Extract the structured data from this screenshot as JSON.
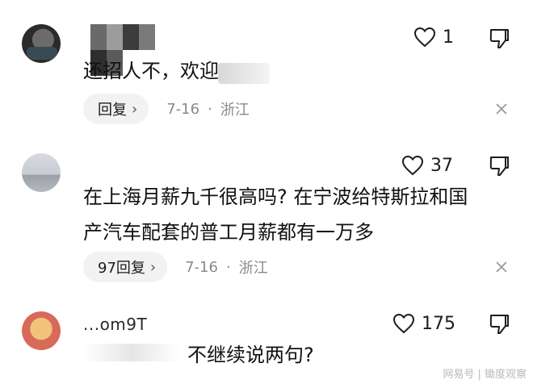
{
  "comments": [
    {
      "username": "",
      "likes": "1",
      "text": "还招人不，欢迎",
      "reply_label": "回复",
      "date": "7-16",
      "region": "浙江"
    },
    {
      "username": "",
      "likes": "37",
      "text_line1": "在上海月薪九千很高吗? 在宁波给特斯拉和国",
      "text_line2": "产汽车配套的普工月薪都有一万多",
      "reply_label": "97回复",
      "date": "7-16",
      "region": "浙江"
    },
    {
      "username": "...om9T",
      "likes": "175",
      "text": "不继续说两句?"
    }
  ],
  "watermark": "网易号 | 锄度观察",
  "icons": {
    "like": "heart-outline-icon",
    "dislike": "thumbs-down-icon",
    "close": "close-icon",
    "chevron": "chevron-right-icon"
  },
  "colors": {
    "text": "#1c1c1c",
    "meta": "#8a8a8a",
    "reply_bg": "#f2f2f2",
    "background": "#ffffff"
  }
}
